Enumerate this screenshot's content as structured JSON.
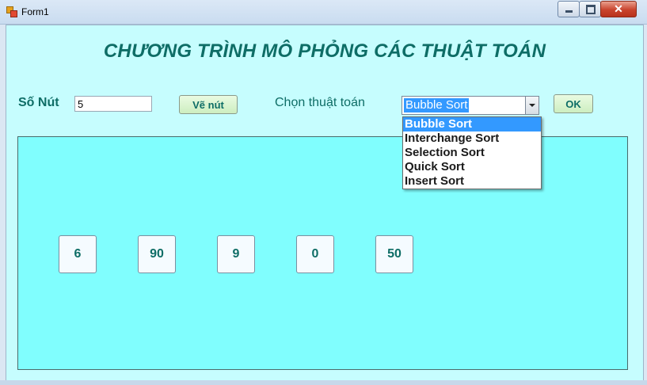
{
  "window": {
    "title": "Form1"
  },
  "header": {
    "title": "CHƯƠNG TRÌNH MÔ PHỎNG CÁC THUẬT TOÁN"
  },
  "controls": {
    "node_count_label": "Số Nút",
    "node_count_value": "5",
    "draw_button": "Vẽ nút",
    "algorithm_label": "Chọn thuật toán",
    "algorithm_selected": "Bubble Sort",
    "ok_button": "OK",
    "algorithm_options": [
      "Bubble Sort",
      "Interchange Sort",
      "Selection Sort",
      "Quick Sort",
      "Insert Sort"
    ]
  },
  "nodes": [
    "6",
    "90",
    "9",
    "0",
    "50"
  ],
  "colors": {
    "client_bg": "#c6fdfe",
    "panel_bg": "#80fefe",
    "text_accent": "#0e6d66",
    "highlight": "#3399ff"
  },
  "icons": {
    "app": "form-app-icon",
    "minimize": "minimize-icon",
    "maximize": "maximize-icon",
    "close": "close-icon",
    "dropdown": "chevron-down-icon"
  }
}
